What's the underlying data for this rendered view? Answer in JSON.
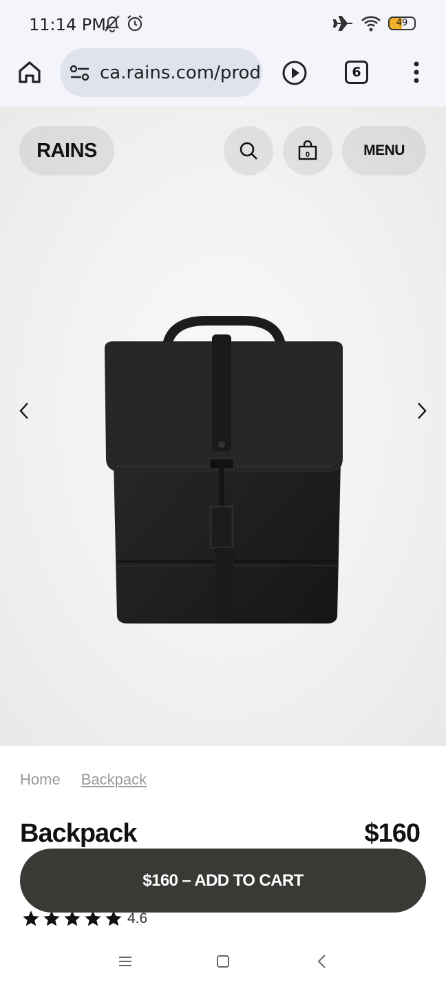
{
  "status_bar": {
    "time": "11:14 PM",
    "battery_level": "49",
    "battery_fraction": 0.49,
    "battery_color": "#f2b12b",
    "icons": [
      "bell-off-icon",
      "alarm-icon",
      "airplane-icon",
      "wifi-icon",
      "battery-icon"
    ]
  },
  "browser": {
    "url": "ca.rains.com/products/backpack",
    "tab_count": "6",
    "icons": [
      "home-icon",
      "site-settings-icon",
      "play-icon",
      "tabs-icon",
      "more-vert-icon"
    ]
  },
  "header": {
    "logo": "RAINS",
    "cart_count": "0",
    "menu_label": "MENU"
  },
  "breadcrumb": {
    "items": [
      "Home",
      "Backpack"
    ]
  },
  "product": {
    "name": "Backpack",
    "price": "$160",
    "rating": "4.6",
    "stars": 5,
    "color": "#1f1f1f"
  },
  "actions": {
    "add_to_cart": "$160 – ADD TO CART"
  },
  "nav": {
    "icons": [
      "recent-apps-icon",
      "home-icon",
      "back-icon"
    ]
  }
}
